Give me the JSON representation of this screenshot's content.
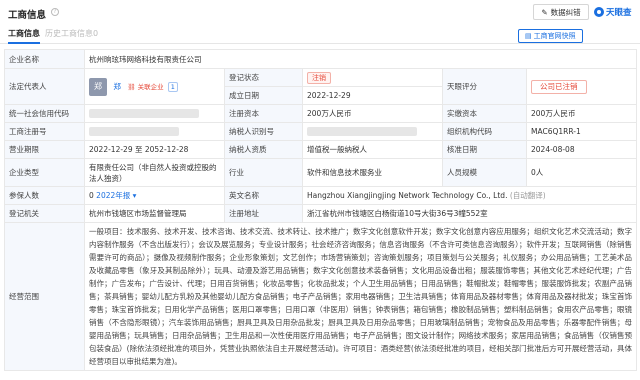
{
  "header": {
    "title": "工商信息",
    "error_button": "数据纠错",
    "brand_name": "天眼查"
  },
  "tabs": [
    "工商信息",
    "历史工商信息0"
  ],
  "official_button": "工商官网快照",
  "company": {
    "name_label": "企业名称",
    "name": "杭州晌玹玮网络科技有限责任公司",
    "rep_label": "法定代表人",
    "rep_avatar": "郑",
    "rep_name": "郑",
    "rep_related": "关联企业",
    "rep_related_count": "1",
    "status_label": "登记状态",
    "status": "注销",
    "rating_label": "天眼评分",
    "rating": "公司已注销",
    "found_label": "成立日期",
    "found": "2022-12-29",
    "credit_label": "统一社会信用代码",
    "capital_label": "注册资本",
    "capital": "200万人民币",
    "paid_label": "实缴资本",
    "paid": "200万人民币",
    "reg_no_label": "工商注册号",
    "taxpayer_no_label": "纳税人识别号",
    "org_code_label": "组织机构代码",
    "org_code": "MAC6Q1RR-1",
    "term_label": "营业期限",
    "term": "2022-12-29 至 2052-12-28",
    "taxpayer_label": "纳税人资质",
    "taxpayer": "增值税一般纳税人",
    "approve_label": "核准日期",
    "approve": "2024-08-08",
    "type_label": "企业类型",
    "type": "有限责任公司（非自然人投资或控股的法人独资）",
    "industry_label": "行业",
    "industry": "软件和信息技术服务业",
    "staff_label": "人员规模",
    "staff": "0人",
    "insured_label": "参保人数",
    "insured": "0",
    "insured_year": "2022年报",
    "en_name_label": "英文名称",
    "en_name": "Hangzhou Xiangjingjing Network Technology Co., Ltd.",
    "en_name_note": "(自动翻译)",
    "authority_label": "登记机关",
    "authority": "杭州市钱塘区市场监督管理局",
    "address_label": "注册地址",
    "address": "浙江省杭州市钱塘区白杨街道10号大街36号3幢552室",
    "scope_label": "经营范围",
    "scope": "一般项目：技术服务、技术开发、技术咨询、技术交流、技术转让、技术推广；数字文化创意软件开发；数字文化创意内容应用服务；组织文化艺术交流活动；数字内容制作服务（不含出版发行）；会议及展览服务；专业设计服务；社会经济咨询服务；信息咨询服务（不含许可类信息咨询服务）；软件开发；互联网销售（除销售需要许可的商品）；摄像及视频制作服务；企业形象策划；文艺创作；市场营销策划；咨询策划服务；项目策划与公关服务；礼仪服务；办公用品销售；工艺美术品及收藏品零售（象牙及其制品除外）；玩具、动漫及游艺用品销售；数字文化创意技术装备销售；文化用品设备出租；服装服饰零售；其他文化艺术经纪代理；广告制作；广告发布；广告设计、代理；日用百货销售；化妆品零售；化妆品批发；个人卫生用品销售；日用品销售；鞋帽批发；鞋帽零售；服装服饰批发；农副产品销售；茶具销售；婴幼儿配方乳粉及其他婴幼儿配方食品销售；电子产品销售；家用电器销售；卫生洁具销售；体育用品及器材零售；体育用品及器材批发；珠宝首饰零售；珠宝首饰批发；日用化学产品销售；医用口罩零售；日用口罩（非医用）销售；钟表销售；箱包销售；橡胶制品销售；塑料制品销售；食用农产品零售；眼镜销售（不含隐形眼镜）；汽车装饰用品销售；厨具卫具及日用杂品批发；厨具卫具及日用杂品零售；日用玻璃制品销售；宠物食品及用品零售；乐器零配件销售；母婴用品销售；玩具销售；日用杂品销售；卫生用品和一次性使用医疗用品销售；电子产品销售；图文设计制作；网络技术服务；家居用品销售；食品销售（仅销售预包装食品）(除依法须经批准的项目外，凭营业执照依法自主开展经营活动)。许可项目：酒类经营(依法须经批准的项目，经相关部门批准后方可开展经营活动，具体经营项目以审批结果为准)。"
  }
}
